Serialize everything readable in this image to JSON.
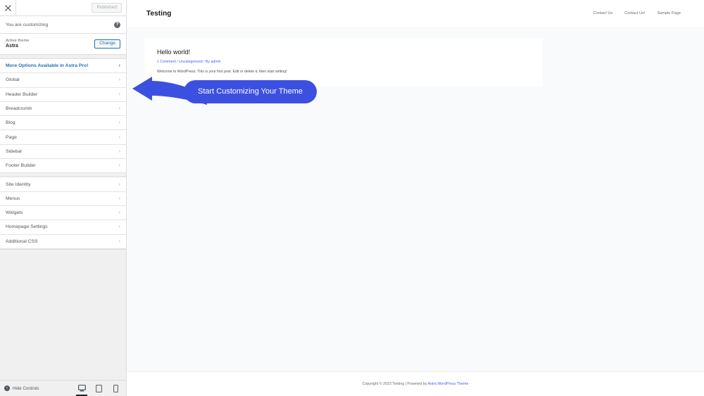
{
  "customizer": {
    "close_icon": "close-icon",
    "publish_label": "Published",
    "customizing_label": "You are customizing",
    "help_icon": "help-icon",
    "help_glyph": "?",
    "theme": {
      "label": "Active theme",
      "name": "Astra",
      "change_label": "Change"
    },
    "panels": [
      {
        "label": "More Options Available in Astra Pro!",
        "highlight": true
      },
      {
        "label": "Global",
        "highlight": false
      },
      {
        "label": "Header Builder",
        "highlight": false
      },
      {
        "label": "Breadcrumb",
        "highlight": false
      },
      {
        "label": "Blog",
        "highlight": false
      },
      {
        "label": "Page",
        "highlight": false
      },
      {
        "label": "Sidebar",
        "highlight": false
      },
      {
        "label": "Footer Builder",
        "highlight": false
      }
    ],
    "panels_group2": [
      {
        "label": "Site Identity"
      },
      {
        "label": "Menus"
      },
      {
        "label": "Widgets"
      },
      {
        "label": "Homepage Settings"
      },
      {
        "label": "Additional CSS"
      }
    ],
    "chevron_glyph": "›",
    "footer": {
      "hide_controls_label": "Hide Controls",
      "hide_controls_glyph": "‹",
      "devices": [
        {
          "name": "desktop",
          "active": true
        },
        {
          "name": "tablet",
          "active": false
        },
        {
          "name": "mobile",
          "active": false
        }
      ]
    }
  },
  "preview": {
    "site_title": "Testing",
    "nav": [
      {
        "label": "Contact Us"
      },
      {
        "label": "Contact Us!"
      },
      {
        "label": "Sample Page"
      }
    ],
    "post": {
      "title": "Hello world!",
      "meta_comment": "1 Comment",
      "meta_sep1": " / ",
      "meta_category": "Uncategorized",
      "meta_sep2": " / ",
      "meta_author": "By admin",
      "excerpt": "Welcome to WordPress. This is your first post. Edit or delete it, then start writing!"
    },
    "footer": {
      "text": "Copyright © 2023 Testing | Powered by ",
      "link": "Astra WordPress Theme"
    }
  },
  "callout": {
    "cta_label": "Start Customizing Your Theme",
    "arrow_icon": "left-arrow-icon",
    "accent_color": "#3b50e0"
  }
}
